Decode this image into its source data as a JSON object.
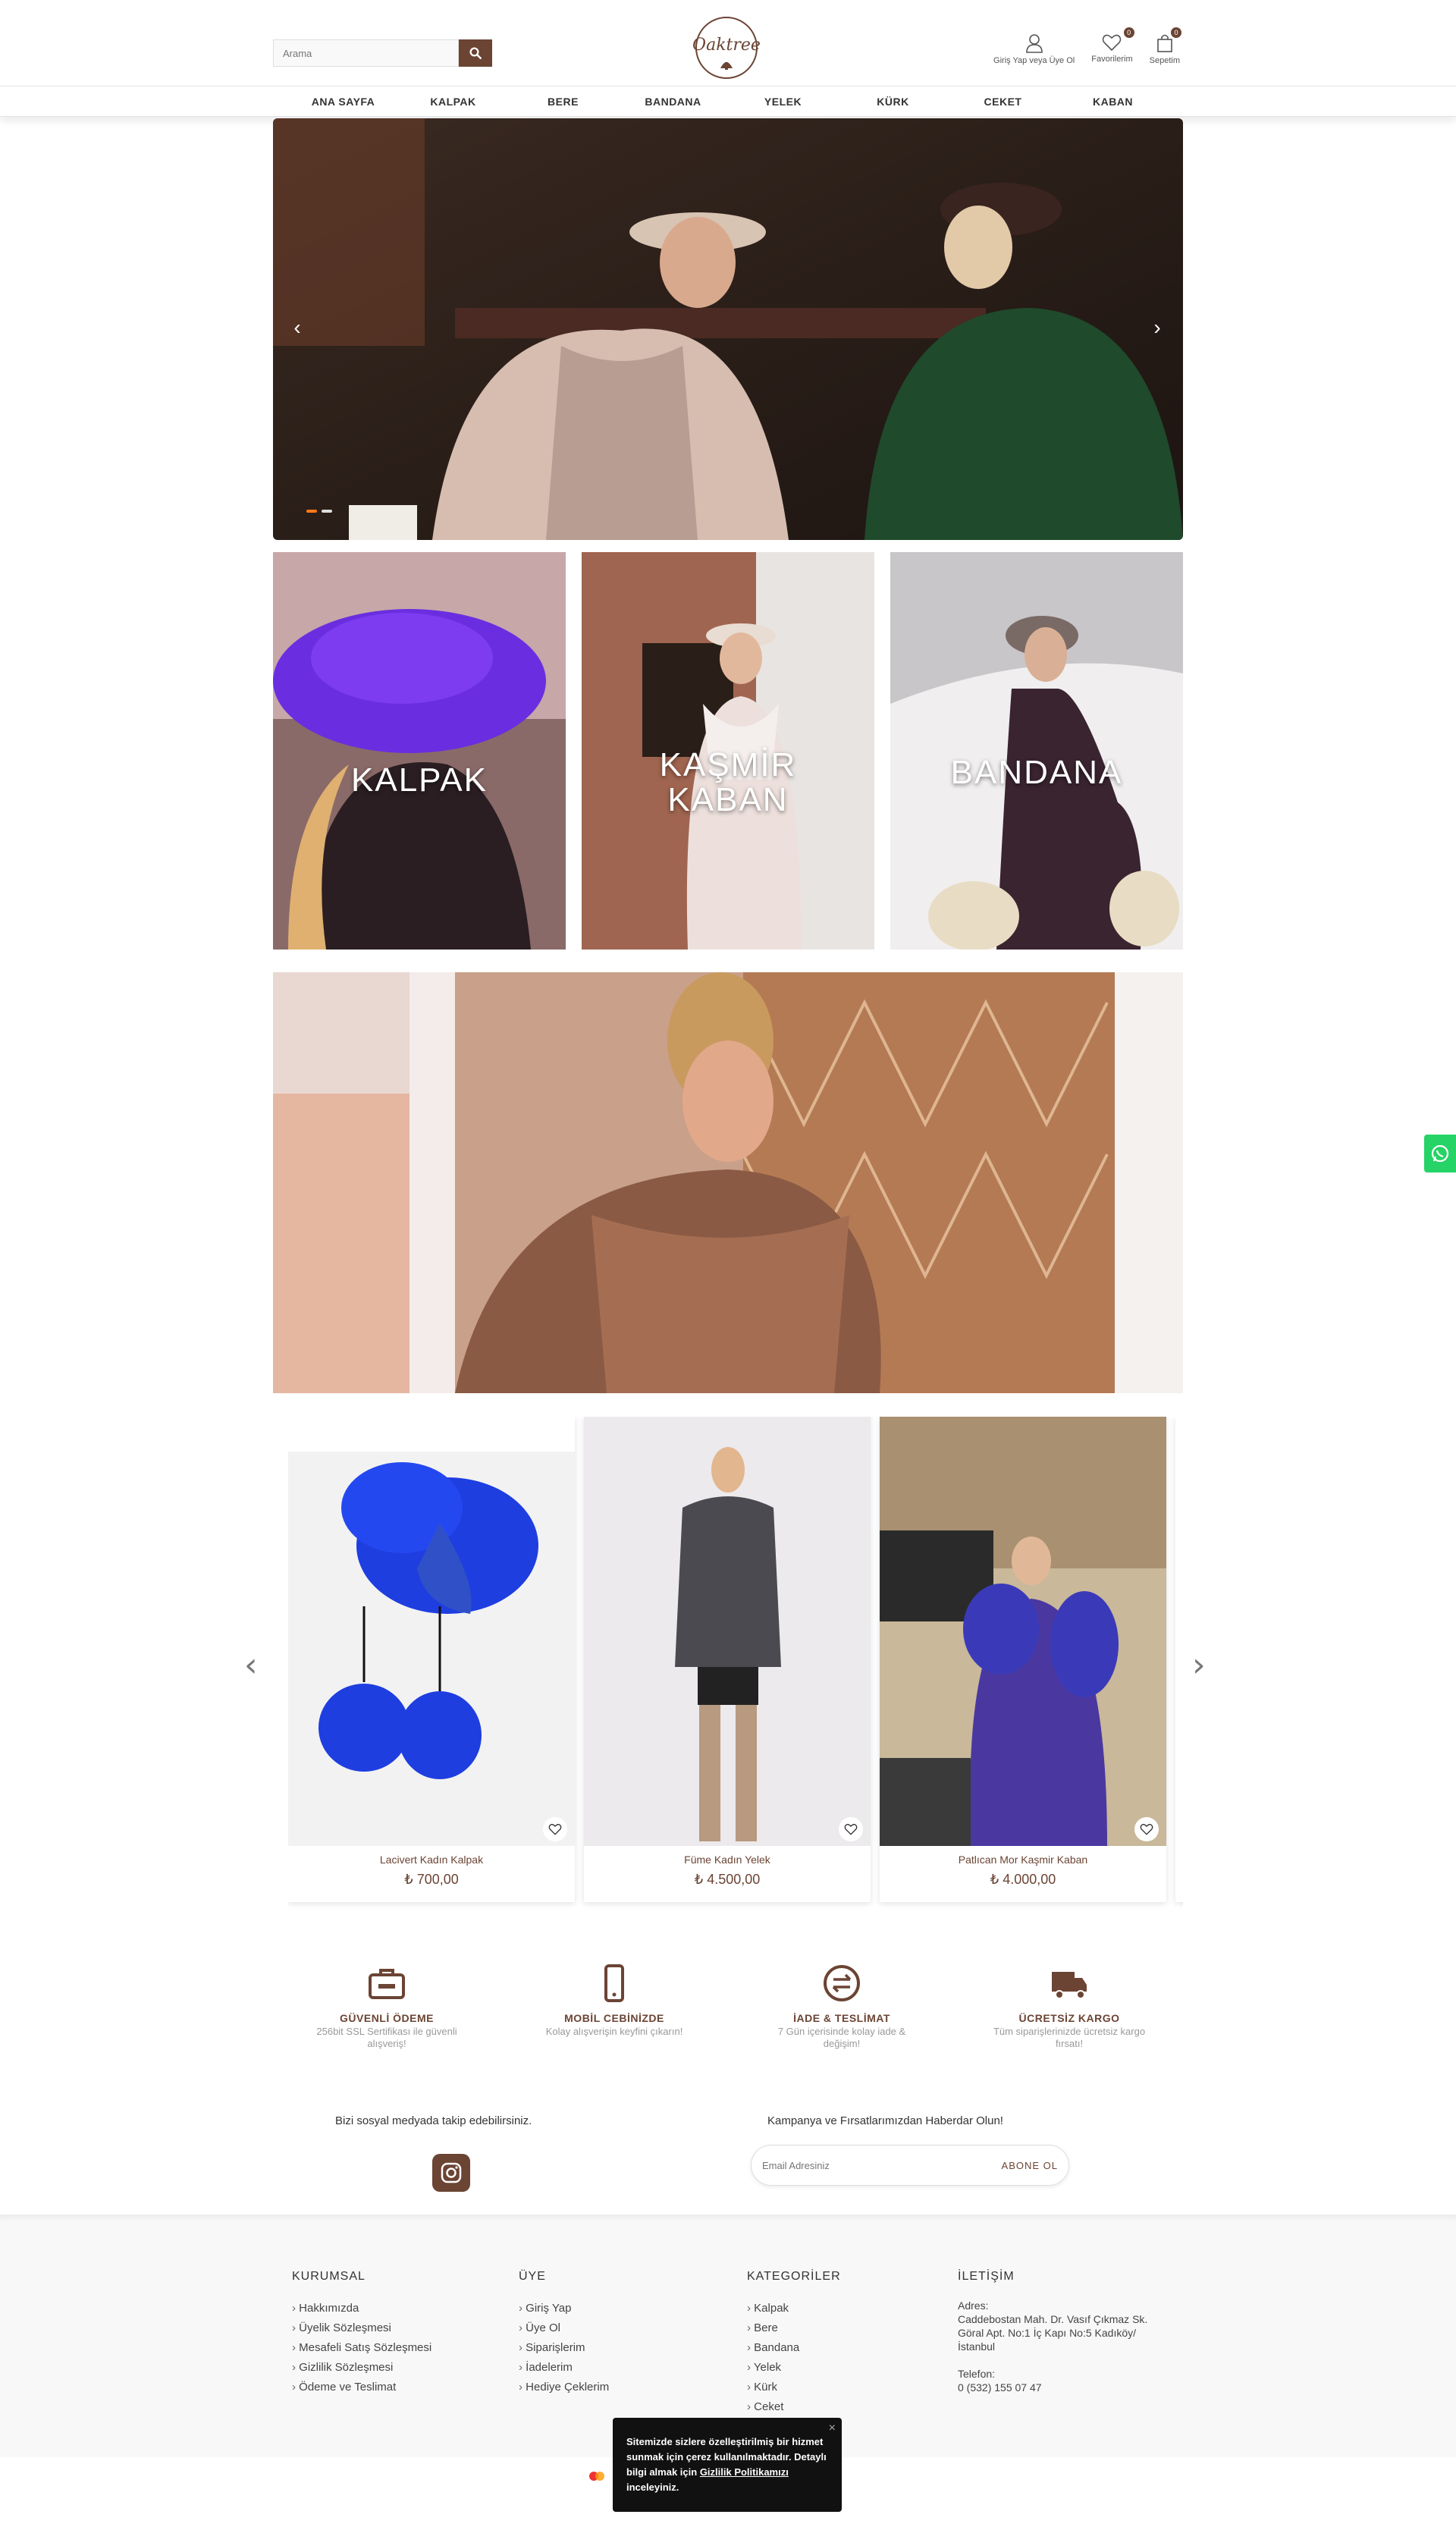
{
  "header": {
    "search_placeholder": "Arama",
    "account_label": "Giriş Yap veya Üye Ol",
    "favorites_label": "Favorilerim",
    "favorites_count": "0",
    "cart_label": "Sepetim",
    "cart_count": "0"
  },
  "nav": {
    "items": [
      "ANA SAYFA",
      "KALPAK",
      "BERE",
      "BANDANA",
      "YELEK",
      "KÜRK",
      "CEKET",
      "KABAN"
    ]
  },
  "categories": [
    {
      "label_lines": [
        "KALPAK"
      ]
    },
    {
      "label_lines": [
        "KAŞMİR",
        "KABAN"
      ]
    },
    {
      "label_lines": [
        "BANDANA"
      ]
    }
  ],
  "products": [
    {
      "name": "Lacivert Kadın Kalpak",
      "price": "₺ 700,00"
    },
    {
      "name": "Füme Kadın Yelek",
      "price": "₺ 4.500,00"
    },
    {
      "name": "Patlıcan Mor Kaşmir Kaban",
      "price": "₺ 4.000,00"
    }
  ],
  "features": [
    {
      "title": "GÜVENLİ ÖDEME",
      "desc": "256bit SSL Sertifikası ile güvenli alışveriş!",
      "icon": "briefcase-icon"
    },
    {
      "title": "MOBİL CEBİNİZDE",
      "desc": "Kolay alışverişin keyfini çıkarın!",
      "icon": "mobile-icon"
    },
    {
      "title": "İADE & TESLİMAT",
      "desc": "7 Gün içerisinde kolay iade & değişim!",
      "icon": "exchange-icon"
    },
    {
      "title": "ÜCRETSİZ KARGO",
      "desc": "Tüm siparişlerinizde ücretsiz kargo fırsatı!",
      "icon": "truck-icon"
    }
  ],
  "social": {
    "title": "Bizi sosyal medyada takip edebilirsiniz."
  },
  "newsletter": {
    "title": "Kampanya ve Fırsatlarımızdan Haberdar Olun!",
    "placeholder": "Email Adresiniz",
    "button": "ABONE OL"
  },
  "footer": {
    "corporate": {
      "title": "KURUMSAL",
      "links": [
        "Hakkımızda",
        "Üyelik Sözleşmesi",
        "Mesafeli Satış Sözleşmesi",
        "Gizlilik Sözleşmesi",
        "Ödeme ve Teslimat"
      ]
    },
    "member": {
      "title": "ÜYE",
      "links": [
        "Giriş Yap",
        "Üye Ol",
        "Siparişlerim",
        "İadelerim",
        "Hediye Çeklerim"
      ]
    },
    "categories": {
      "title": "KATEGORİLER",
      "links": [
        "Kalpak",
        "Bere",
        "Bandana",
        "Yelek",
        "Kürk",
        "Ceket"
      ]
    },
    "contact": {
      "title": "İLETİŞİM",
      "address_label": "Adres:",
      "address": "Caddebostan Mah. Dr. Vasıf Çıkmaz Sk. Göral Apt. No:1 İç Kapı No:5 Kadıköy/İstanbul",
      "phone_label": "Telefon:",
      "phone": "0 (532) 155 07 47"
    }
  },
  "cookie": {
    "text_before": "Sitemizde sizlere özelleştirilmiş bir hizmet sunmak için çerez kullanılmaktadır. Detaylı bilgi almak için ",
    "link": "Gizlilik Politikamızı",
    "text_after": " inceleyiniz.",
    "close": "×"
  },
  "colors": {
    "brand": "#6b4434",
    "accent": "#ff7a1a",
    "whatsapp": "#25d366"
  }
}
